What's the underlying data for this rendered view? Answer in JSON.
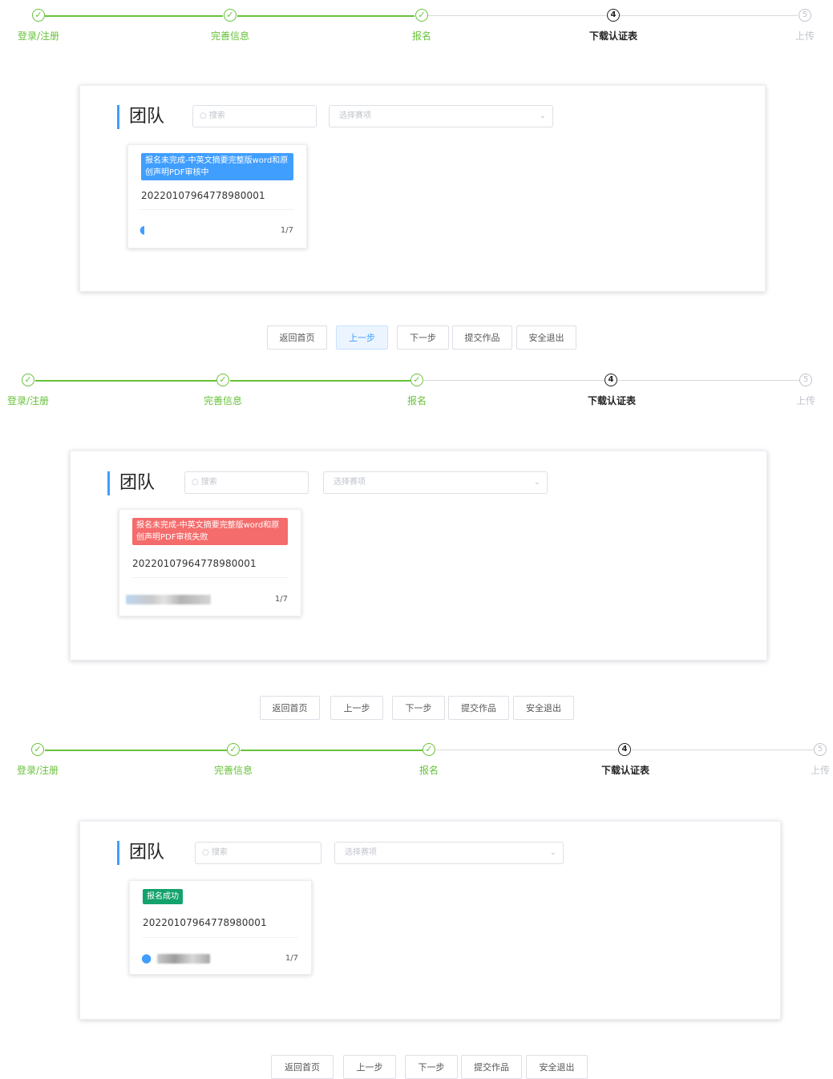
{
  "steps": [
    {
      "index": "1",
      "label": "登录/注册",
      "state": "done"
    },
    {
      "index": "2",
      "label": "完善信息",
      "state": "done"
    },
    {
      "index": "3",
      "label": "报名",
      "state": "done"
    },
    {
      "index": "4",
      "label": "下载认证表",
      "state": "current"
    },
    {
      "index": "5",
      "label": "上传",
      "state": "wait"
    }
  ],
  "icons": {
    "check": "check-icon",
    "search": "search-icon",
    "chevron": "chevron-down-icon",
    "user": "user-icon"
  },
  "panel": {
    "title": "团队",
    "search_placeholder": "搜索",
    "select_placeholder": "选择赛项"
  },
  "cards": [
    {
      "status": "报名未完成-中英文摘要完整版word和原创声明PDF审核中",
      "status_color": "#409eff",
      "id": "20220107964778980001",
      "page": "1/7"
    },
    {
      "status": "报名未完成-中英文摘要完整版word和原创声明PDF审核失败",
      "status_color": "#f56c6c",
      "id": "20220107964778980001",
      "page": "1/7"
    },
    {
      "status": "报名成功",
      "status_color": "#13a26b",
      "id": "20220107964778980001",
      "page": "1/7"
    }
  ],
  "buttons": {
    "home": "返回首页",
    "prev": "上一步",
    "next": "下一步",
    "submit": "提交作品",
    "logout": "安全退出"
  }
}
